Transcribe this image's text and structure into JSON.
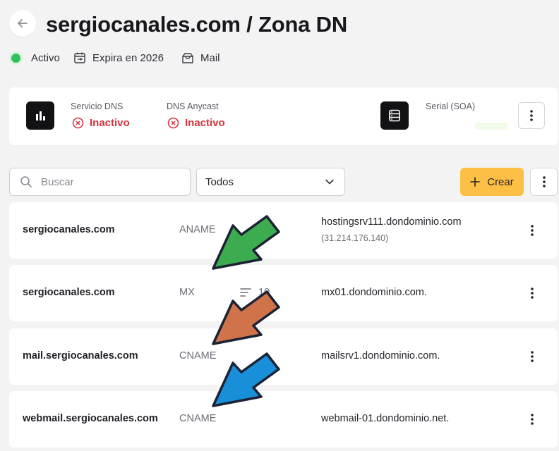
{
  "header": {
    "title": "sergiocanales.com / Zona DN",
    "status_label": "Activo",
    "expira_label": "Expira en 2026",
    "mail_label": "Mail"
  },
  "dns_card": {
    "servicio_label": "Servicio DNS",
    "servicio_status": "Inactivo",
    "anycast_label": "DNS Anycast",
    "anycast_status": "Inactivo",
    "serial_label": "Serial (SOA)"
  },
  "toolbar": {
    "search_placeholder": "Buscar",
    "filter_value": "Todos",
    "create_label": "Crear"
  },
  "records": [
    {
      "host": "sergiocanales.com",
      "type": "ANAME",
      "value": "hostingsrv111.dondominio.com",
      "sub": "(31.214.176.140)"
    },
    {
      "host": "sergiocanales.com",
      "type": "MX",
      "priority": "10",
      "value": "mx01.dondominio.com."
    },
    {
      "host": "mail.sergiocanales.com",
      "type": "CNAME",
      "value": "mailsrv1.dondominio.com."
    },
    {
      "host": "webmail.sergiocanales.com",
      "type": "CNAME",
      "value": "webmail-01.dondominio.net."
    }
  ],
  "icons": {
    "back": "arrow-left-icon",
    "status": "status-dot-icon",
    "calendar": "calendar-sync-icon",
    "mail": "inbox-icon",
    "dns": "bar-chart-icon",
    "soa": "server-icon",
    "inactive": "x-circle-icon",
    "search": "search-icon",
    "chevron": "chevron-down-icon",
    "plus": "plus-icon",
    "more": "kebab-menu-icon",
    "priority": "sort-lines-icon"
  },
  "colors": {
    "active": "#2fc25b",
    "inactive": "#d6333c",
    "accent": "#fdbf45",
    "arrow_green": "#3dab4f",
    "arrow_orange": "#d0734a",
    "arrow_blue": "#1a8fd9"
  }
}
